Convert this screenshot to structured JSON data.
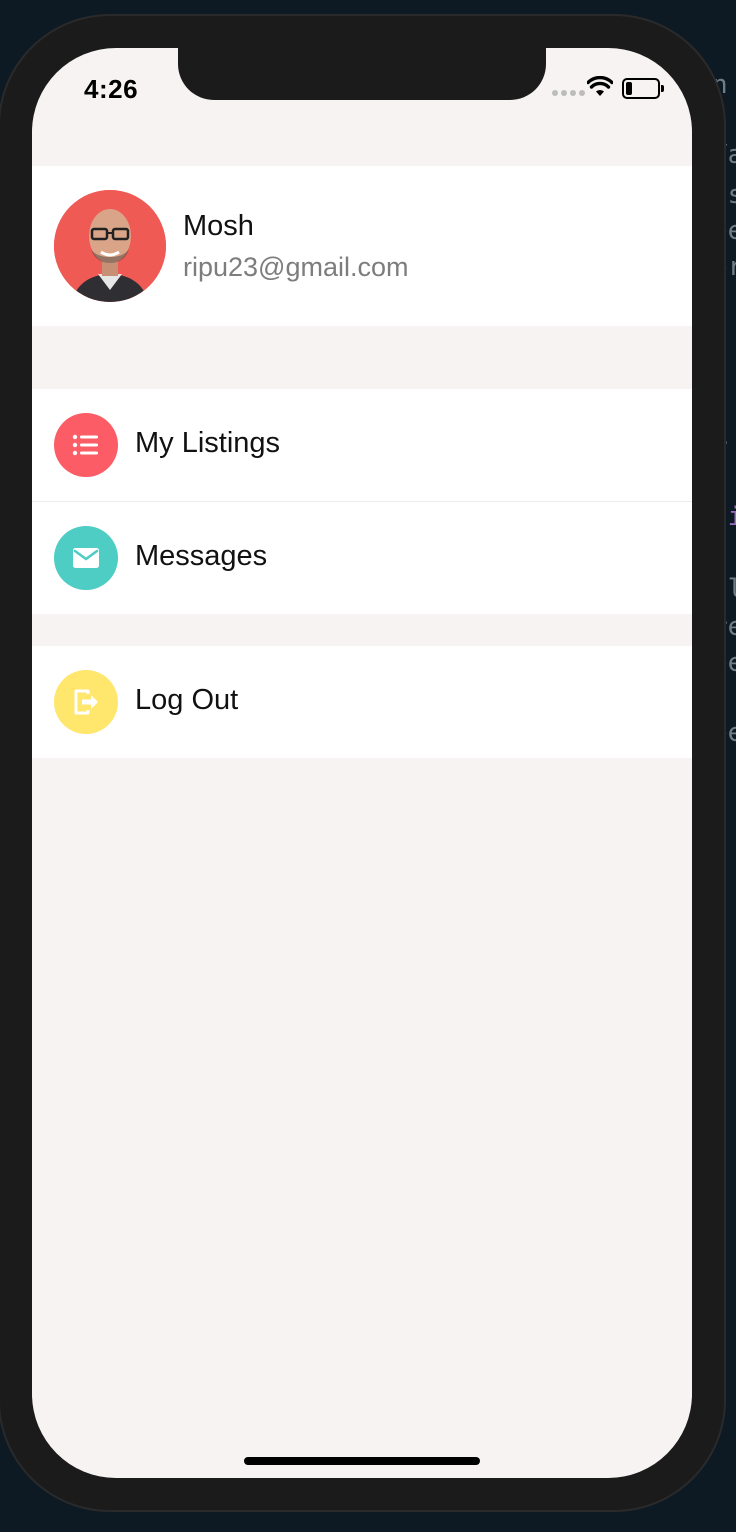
{
  "status_bar": {
    "time": "4:26"
  },
  "profile": {
    "name": "Mosh",
    "email": "ripu23@gmail.com"
  },
  "menu": {
    "items": [
      {
        "label": "My Listings",
        "icon": "list-icon",
        "color": "#fc5c65"
      },
      {
        "label": "Messages",
        "icon": "email-icon",
        "color": "#4ecdc4"
      }
    ]
  },
  "logout": {
    "label": "Log Out",
    "icon": "logout-icon",
    "color": "#ffe66d"
  },
  "background_code": {
    "lines": [
      "n",
      "Ya",
      "ls",
      "ee",
      "er",
      "m",
      "a",
      "r",
      "ti",
      "il",
      "re",
      "ee",
      "ee"
    ]
  }
}
